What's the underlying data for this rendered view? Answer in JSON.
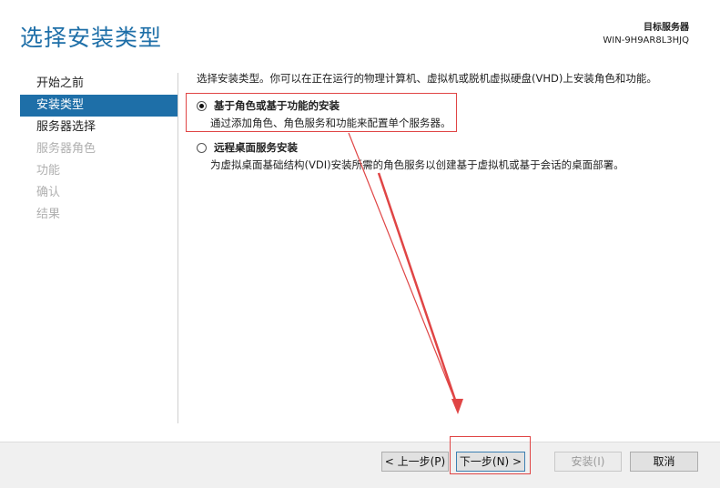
{
  "header": {
    "title": "选择安装类型",
    "target_label": "目标服务器",
    "target_server": "WIN-9H9AR8L3HJQ"
  },
  "sidebar": {
    "items": [
      {
        "label": "开始之前",
        "state": "normal"
      },
      {
        "label": "安装类型",
        "state": "active"
      },
      {
        "label": "服务器选择",
        "state": "normal"
      },
      {
        "label": "服务器角色",
        "state": "disabled"
      },
      {
        "label": "功能",
        "state": "disabled"
      },
      {
        "label": "确认",
        "state": "disabled"
      },
      {
        "label": "结果",
        "state": "disabled"
      }
    ]
  },
  "main": {
    "description": "选择安装类型。你可以在正在运行的物理计算机、虚拟机或脱机虚拟硬盘(VHD)上安装角色和功能。",
    "options": [
      {
        "name": "基于角色或基于功能的安装",
        "desc": "通过添加角色、角色服务和功能来配置单个服务器。",
        "selected": true
      },
      {
        "name": "远程桌面服务安装",
        "desc": "为虚拟桌面基础结构(VDI)安装所需的角色服务以创建基于虚拟机或基于会话的桌面部署。",
        "selected": false
      }
    ]
  },
  "footer": {
    "prev": "< 上一步(P)",
    "next": "下一步(N) >",
    "install": "安装(I)",
    "cancel": "取消"
  },
  "colors": {
    "accent": "#1e6fa8",
    "annotation": "#e04545"
  }
}
